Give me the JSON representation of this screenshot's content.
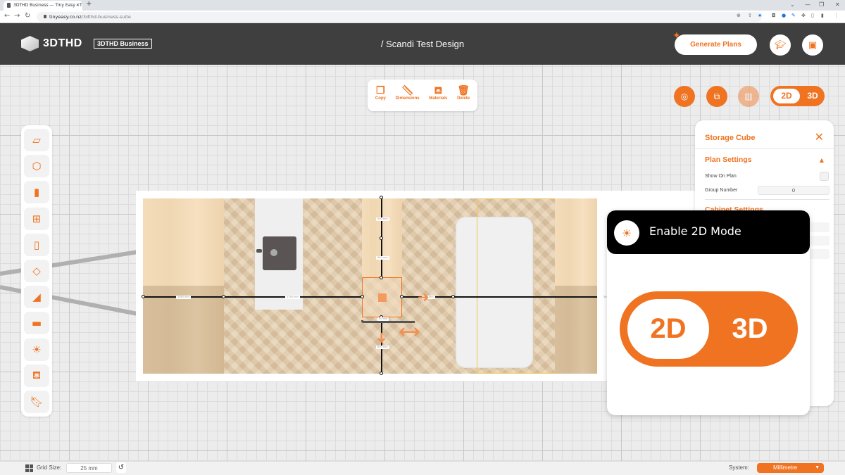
{
  "browser": {
    "tab_title": "3DTHD Business — Tiny Easy - Ti",
    "url_host": "tinyeasy.co.nz",
    "url_path": "/3dthd-business-suite"
  },
  "header": {
    "logo_text": "3DTHD",
    "edition_badge": "3DTHD Business",
    "design_title": "/ Scandi Test Design",
    "generate_plans_label": "Generate Plans"
  },
  "object_toolbar": {
    "items": [
      {
        "label": "Copy",
        "icon": "copy-icon"
      },
      {
        "label": "Dimensions",
        "icon": "ruler-icon"
      },
      {
        "label": "Materials",
        "icon": "paint-bucket-icon"
      },
      {
        "label": "Delete",
        "icon": "trash-icon"
      }
    ]
  },
  "view_toggle": {
    "option_2d": "2D",
    "option_3d": "3D",
    "selected": "2D"
  },
  "sidebar": {
    "items": [
      {
        "name": "floor-tool",
        "icon": "floor-icon"
      },
      {
        "name": "room-tool",
        "icon": "cube-room-icon"
      },
      {
        "name": "door-tool",
        "icon": "door-icon"
      },
      {
        "name": "window-tool",
        "icon": "window-icon"
      },
      {
        "name": "wall-panel-tool",
        "icon": "panel-icon"
      },
      {
        "name": "slab-tool",
        "icon": "slab-icon"
      },
      {
        "name": "stairs-tool",
        "icon": "stairs-icon"
      },
      {
        "name": "furniture-tool",
        "icon": "sofa-icon"
      },
      {
        "name": "lighting-tool",
        "icon": "lightbulb-icon"
      },
      {
        "name": "materials-tool",
        "icon": "paint-bucket-icon"
      },
      {
        "name": "bookmark-tool",
        "icon": "bookmark-icon"
      }
    ]
  },
  "plan": {
    "dimension_labels": [
      "1060 mm",
      "1750 mm",
      "500 mm",
      "600 mm",
      "150 mm",
      "50 mm",
      "800 mm",
      "380"
    ]
  },
  "properties_panel": {
    "title": "Storage Cube",
    "plan_settings_heading": "Plan Settings",
    "show_on_plan_label": "Show On Plan",
    "show_on_plan_checked": false,
    "group_number_label": "Group Number",
    "group_number_value": "0",
    "cabinet_settings_heading": "Cabinet Settings"
  },
  "tip_popup": {
    "title": "Enable 2D Mode",
    "toggle_2d": "2D",
    "toggle_3d": "3D"
  },
  "footer": {
    "grid_size_label": "Grid Size:",
    "grid_size_value": "25 mm",
    "system_label": "System:",
    "system_value": "Millimetre"
  },
  "theme": {
    "accent": "#ef7321",
    "header_bg": "#3f3f3f"
  }
}
